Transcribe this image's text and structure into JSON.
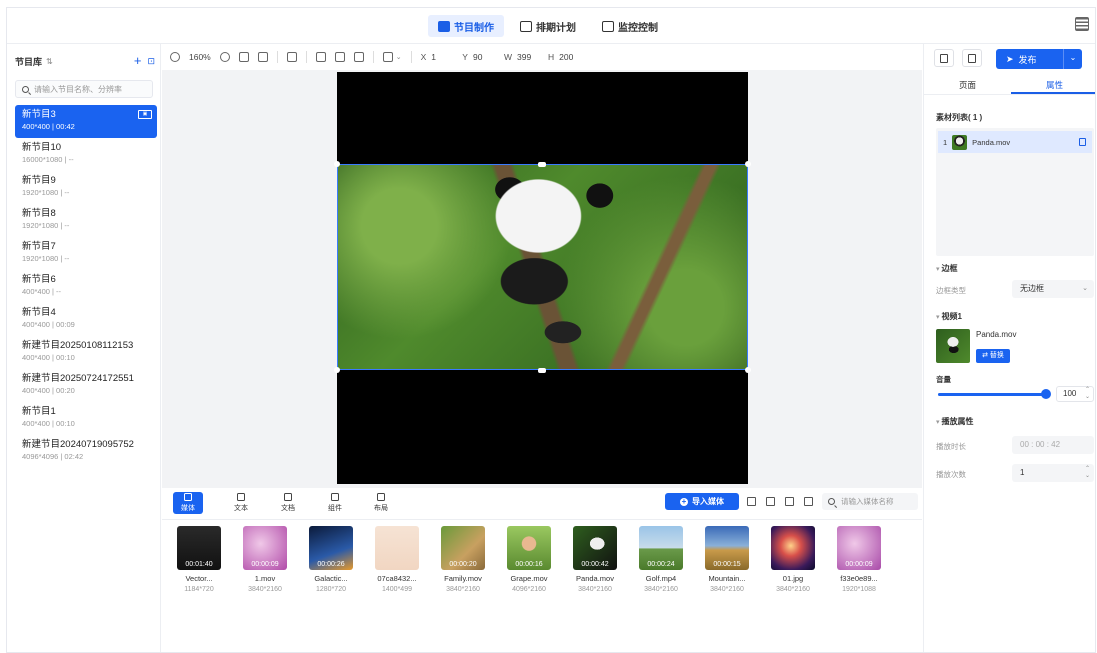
{
  "nav": {
    "tabs": [
      {
        "label": "节目制作",
        "icon": "monitor-icon",
        "active": true
      },
      {
        "label": "排期计划",
        "icon": "calendar-icon",
        "active": false
      },
      {
        "label": "监控控制",
        "icon": "screen-icon",
        "active": false
      }
    ],
    "accent": "#1a63f0"
  },
  "library": {
    "title": "节目库",
    "search_placeholder": "请输入节目名称、分辨率",
    "programs": [
      {
        "name": "新节目3",
        "meta": "400*400 | 00:42",
        "selected": true
      },
      {
        "name": "新节目10",
        "meta": "16000*1080 | --"
      },
      {
        "name": "新节目9",
        "meta": "1920*1080 | --"
      },
      {
        "name": "新节目8",
        "meta": "1920*1080 | --"
      },
      {
        "name": "新节目7",
        "meta": "1920*1080 | --"
      },
      {
        "name": "新节目6",
        "meta": "400*400 | --"
      },
      {
        "name": "新节目4",
        "meta": "400*400 | 00:09"
      },
      {
        "name": "新建节目20250108112153",
        "meta": "400*400 | 00:10"
      },
      {
        "name": "新建节目20250724172551",
        "meta": "400*400 | 00:20"
      },
      {
        "name": "新节目1",
        "meta": "400*400 | 00:10"
      },
      {
        "name": "新建节目20240719095752",
        "meta": "4096*4096 | 02:42"
      }
    ]
  },
  "toolbar": {
    "zoom": "160%",
    "x_label": "X",
    "x_value": "1",
    "y_label": "Y",
    "y_value": "90",
    "w_label": "W",
    "w_value": "399",
    "h_label": "H",
    "h_value": "200"
  },
  "media_tabs": [
    {
      "label": "媒体",
      "active": true
    },
    {
      "label": "文本"
    },
    {
      "label": "文档"
    },
    {
      "label": "组件"
    },
    {
      "label": "布局"
    }
  ],
  "media_toolbar": {
    "import_label": "导入媒体",
    "search_placeholder": "请输入媒体名称"
  },
  "media_items": [
    {
      "name": "Vector...",
      "size": "1184*720",
      "duration": "00:01:40"
    },
    {
      "name": "1.mov",
      "size": "3840*2160",
      "duration": "00:00:09"
    },
    {
      "name": "Galactic...",
      "size": "1280*720",
      "duration": "00:00:26"
    },
    {
      "name": "07ca8432...",
      "size": "1400*499",
      "duration": ""
    },
    {
      "name": "Family.mov",
      "size": "3840*2160",
      "duration": "00:00:20"
    },
    {
      "name": "Grape.mov",
      "size": "4096*2160",
      "duration": "00:00:16"
    },
    {
      "name": "Panda.mov",
      "size": "3840*2160",
      "duration": "00:00:42"
    },
    {
      "name": "Golf.mp4",
      "size": "3840*2160",
      "duration": "00:00:24"
    },
    {
      "name": "Mountain...",
      "size": "3840*2160",
      "duration": "00:00:15"
    },
    {
      "name": "01.jpg",
      "size": "3840*2160",
      "duration": ""
    },
    {
      "name": "f33e0e89...",
      "size": "1920*1088",
      "duration": "00:00:09"
    }
  ],
  "right": {
    "publish_label": "发布",
    "tabs": [
      {
        "label": "页面"
      },
      {
        "label": "属性",
        "active": true
      }
    ],
    "materials_title": "素材列表( 1 )",
    "materials": [
      {
        "index": "1",
        "name": "Panda.mov"
      }
    ],
    "border_section": "边框",
    "border_type_label": "边框类型",
    "border_type_value": "无边框",
    "video_section": "视频1",
    "video_name": "Panda.mov",
    "replace_label": "替换",
    "volume_label": "音量",
    "volume_value": "100",
    "volume_fraction": 1.0,
    "playback_section": "播放属性",
    "duration_label": "播放时长",
    "duration_value": "00 : 00 : 42",
    "count_label": "播放次数",
    "count_value": "1"
  }
}
